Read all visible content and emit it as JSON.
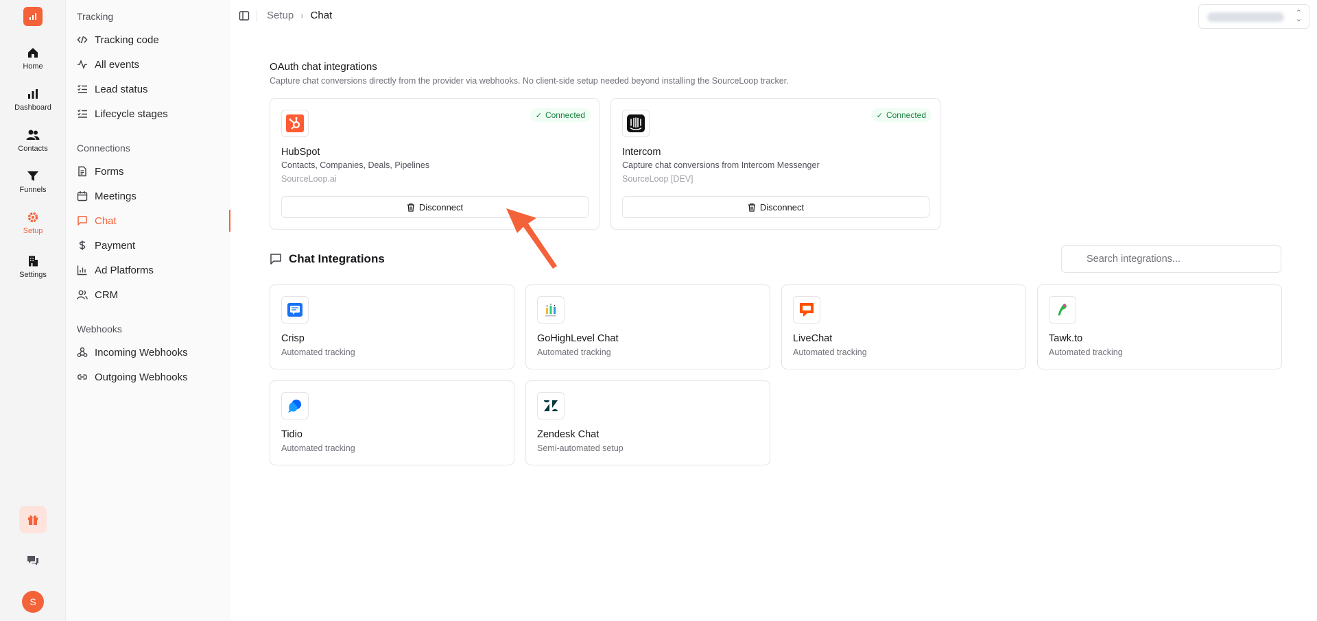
{
  "rail": {
    "items": [
      {
        "label": "Home",
        "icon": "home-icon"
      },
      {
        "label": "Dashboard",
        "icon": "bar-chart-icon"
      },
      {
        "label": "Contacts",
        "icon": "users-icon"
      },
      {
        "label": "Funnels",
        "icon": "funnel-icon"
      },
      {
        "label": "Setup",
        "icon": "gear-icon"
      },
      {
        "label": "Settings",
        "icon": "building-icon"
      }
    ],
    "avatar_initial": "S"
  },
  "sidebar": {
    "groups": [
      {
        "title": "Tracking",
        "items": [
          "Tracking code",
          "All events",
          "Lead status",
          "Lifecycle stages"
        ]
      },
      {
        "title": "Connections",
        "items": [
          "Forms",
          "Meetings",
          "Chat",
          "Payment",
          "Ad Platforms",
          "CRM"
        ]
      },
      {
        "title": "Webhooks",
        "items": [
          "Incoming Webhooks",
          "Outgoing Webhooks"
        ]
      }
    ],
    "active_item": "Chat"
  },
  "breadcrumb": {
    "parent": "Setup",
    "current": "Chat"
  },
  "oauth": {
    "title": "OAuth chat integrations",
    "description": "Capture chat conversions directly from the provider via webhooks. No client-side setup needed beyond installing the SourceLoop tracker.",
    "cards": [
      {
        "name": "HubSpot",
        "description": "Contacts, Companies, Deals, Pipelines",
        "account": "SourceLoop.ai",
        "status": "Connected",
        "button": "Disconnect",
        "icon": "hubspot-icon"
      },
      {
        "name": "Intercom",
        "description": "Capture chat conversions from Intercom Messenger",
        "account": "SourceLoop [DEV]",
        "status": "Connected",
        "button": "Disconnect",
        "icon": "intercom-icon"
      }
    ]
  },
  "chat_integrations": {
    "title": "Chat Integrations",
    "search_placeholder": "Search integrations...",
    "items": [
      {
        "name": "Crisp",
        "subtitle": "Automated tracking",
        "icon": "crisp-icon"
      },
      {
        "name": "GoHighLevel Chat",
        "subtitle": "Automated tracking",
        "icon": "gohighlevel-icon"
      },
      {
        "name": "LiveChat",
        "subtitle": "Automated tracking",
        "icon": "livechat-icon"
      },
      {
        "name": "Tawk.to",
        "subtitle": "Automated tracking",
        "icon": "tawkto-icon"
      },
      {
        "name": "Tidio",
        "subtitle": "Automated tracking",
        "icon": "tidio-icon"
      },
      {
        "name": "Zendesk Chat",
        "subtitle": "Semi-automated setup",
        "icon": "zendesk-icon"
      }
    ]
  },
  "colors": {
    "accent": "#f4623a",
    "connected": "#15803d",
    "border": "#e4e4e7"
  }
}
